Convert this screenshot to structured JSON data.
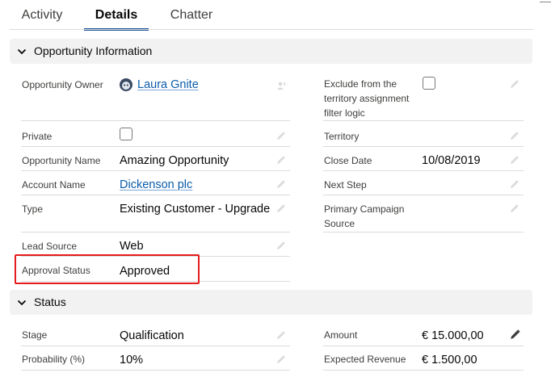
{
  "tabs": [
    {
      "label": "Activity"
    },
    {
      "label": "Details"
    },
    {
      "label": "Chatter"
    }
  ],
  "sections": {
    "opportunity_info": {
      "title": "Opportunity Information"
    },
    "status": {
      "title": "Status"
    }
  },
  "fields": {
    "opportunity_owner": {
      "label": "Opportunity Owner",
      "value": "Laura Gnite"
    },
    "exclude_territory": {
      "label": "Exclude from the territory assignment filter logic",
      "checked": false
    },
    "private": {
      "label": "Private",
      "checked": false
    },
    "territory": {
      "label": "Territory",
      "value": ""
    },
    "opportunity_name": {
      "label": "Opportunity Name",
      "value": "Amazing Opportunity"
    },
    "close_date": {
      "label": "Close Date",
      "value": "10/08/2019"
    },
    "account_name": {
      "label": "Account Name",
      "value": "Dickenson plc"
    },
    "next_step": {
      "label": "Next Step",
      "value": ""
    },
    "type": {
      "label": "Type",
      "value": "Existing Customer - Upgrade"
    },
    "primary_campaign": {
      "label": "Primary Campaign Source",
      "value": ""
    },
    "lead_source": {
      "label": "Lead Source",
      "value": "Web"
    },
    "approval_status": {
      "label": "Approval Status",
      "value": "Approved"
    },
    "stage": {
      "label": "Stage",
      "value": "Qualification"
    },
    "amount": {
      "label": "Amount",
      "value": "€ 15.000,00"
    },
    "probability": {
      "label": "Probability (%)",
      "value": "10%"
    },
    "expected_revenue": {
      "label": "Expected Revenue",
      "value": "€ 1.500,00"
    }
  },
  "colors": {
    "active_tab_underline": "#1b5297",
    "link": "#0b5cab",
    "highlight": "#e51b1b",
    "section_bg": "#f3f2f2"
  }
}
